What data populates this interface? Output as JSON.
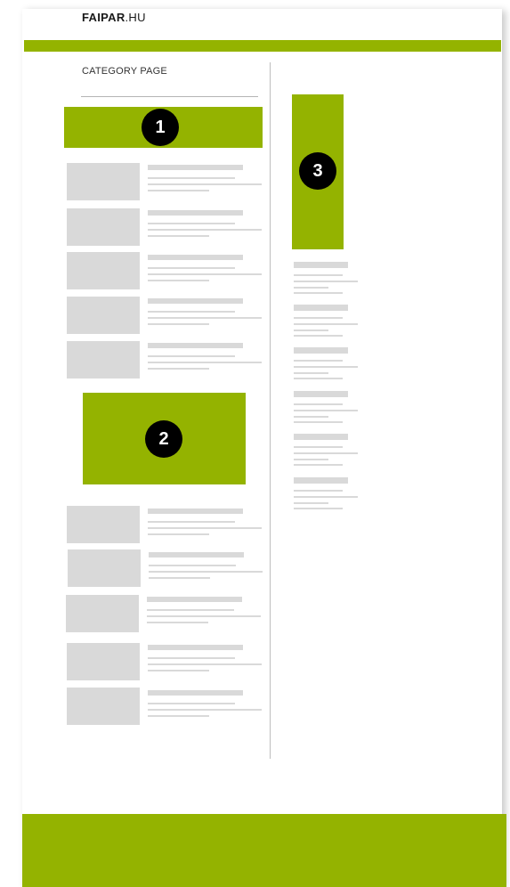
{
  "header": {
    "logo_bold": "FAIPAR",
    "logo_rest": ".HU"
  },
  "category": {
    "title": "CATEGORY PAGE"
  },
  "ads": [
    {
      "badge": "1"
    },
    {
      "badge": "2"
    },
    {
      "badge": "3"
    }
  ],
  "colors": {
    "brand_green": "#94b300",
    "placeholder_gray": "#d9d9d9",
    "badge_black": "#000000"
  }
}
